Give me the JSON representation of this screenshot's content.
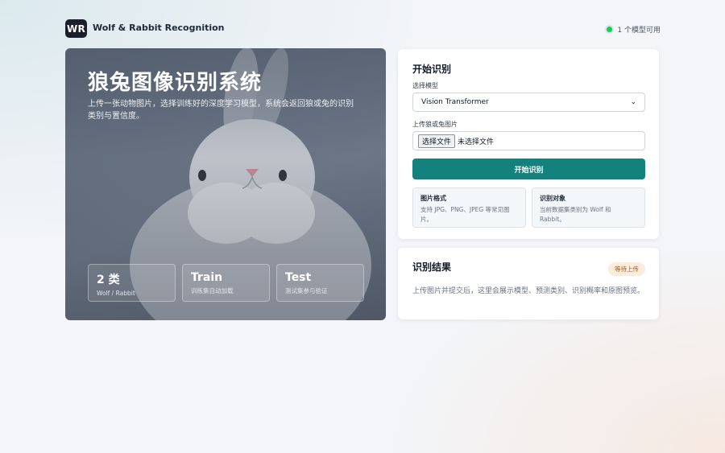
{
  "header": {
    "logo": "WR",
    "brand": "Wolf & Rabbit Recognition",
    "status": "1 个模型可用"
  },
  "hero": {
    "title": "狼兔图像识别系统",
    "description": "上传一张动物图片，选择训练好的深度学习模型，系统会返回狼或兔的识别类别与置信度。",
    "stats": [
      {
        "value": "2 类",
        "label": "Wolf / Rabbit"
      },
      {
        "value": "Train",
        "label": "训练集自动加载"
      },
      {
        "value": "Test",
        "label": "测试集参与验证"
      }
    ]
  },
  "form": {
    "title": "开始识别",
    "model_label": "选择模型",
    "model_selected": "Vision Transformer",
    "upload_label": "上传狼或兔图片",
    "file_button": "选择文件",
    "file_status": "未选择文件",
    "submit_label": "开始识别",
    "info": [
      {
        "title": "图片格式",
        "text": "支持 JPG、PNG、JPEG 等常见图片。"
      },
      {
        "title": "识别对象",
        "text": "当前数据集类别为 Wolf 和 Rabbit。"
      }
    ]
  },
  "result": {
    "title": "识别结果",
    "badge": "等待上传",
    "text": "上传图片并提交后，这里会展示模型、预测类别、识别概率和原图预览。"
  },
  "colors": {
    "accent": "#13817d",
    "status_ok": "#22c55e",
    "badge_bg": "#fdebdc",
    "badge_text": "#a15b1f"
  }
}
